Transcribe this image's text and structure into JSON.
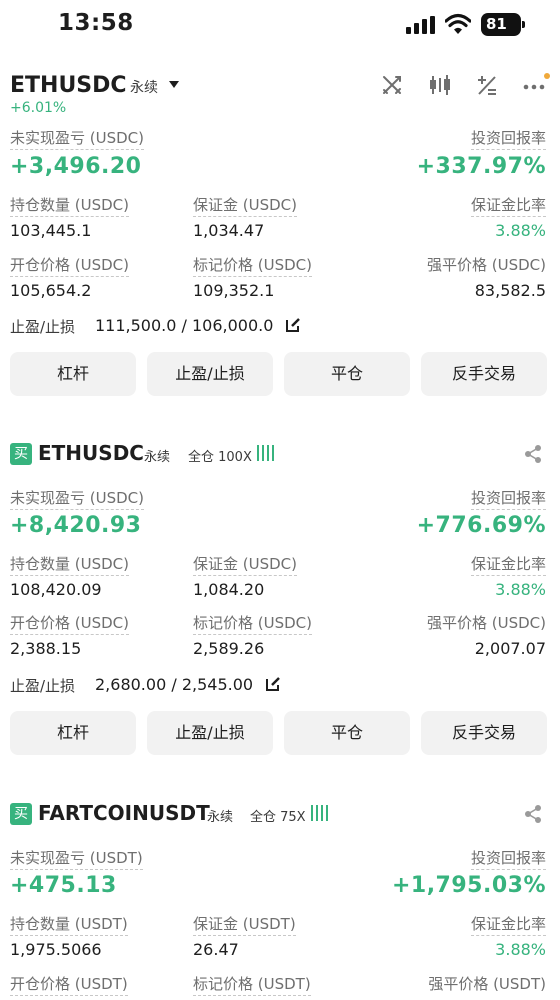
{
  "status_bar": {
    "time": "13:58",
    "battery": "81"
  },
  "header": {
    "symbol": "ETHUSDC",
    "type": "永续",
    "change": "+6.01%"
  },
  "positions": [
    {
      "symbol": "ETHUSDC",
      "type": "永续",
      "side_tag": "",
      "margin_mode": "",
      "unrealized_label": "未实现盈亏 (USDC)",
      "unrealized_value": "+3,496.20",
      "roi_label": "投资回报率",
      "roi_value": "+337.97%",
      "size_label": "持仓数量 (USDC)",
      "size_value": "103,445.1",
      "margin_label": "保证金 (USDC)",
      "margin_value": "1,034.47",
      "margin_ratio_label": "保证金比率",
      "margin_ratio_value": "3.88%",
      "entry_label": "开仓价格 (USDC)",
      "entry_value": "105,654.2",
      "mark_label": "标记价格 (USDC)",
      "mark_value": "109,352.1",
      "liq_label": "强平价格 (USDC)",
      "liq_value": "83,582.5",
      "tpsl_label": "止盈/止损",
      "tpsl_value": "111,500.0 / 106,000.0",
      "buttons": [
        "杠杆",
        "止盈/止损",
        "平仓",
        "反手交易"
      ]
    },
    {
      "symbol": "ETHUSDC",
      "type": "永续",
      "side_tag": "买",
      "margin_mode": "全仓 100X",
      "unrealized_label": "未实现盈亏 (USDC)",
      "unrealized_value": "+8,420.93",
      "roi_label": "投资回报率",
      "roi_value": "+776.69%",
      "size_label": "持仓数量 (USDC)",
      "size_value": "108,420.09",
      "margin_label": "保证金 (USDC)",
      "margin_value": "1,084.20",
      "margin_ratio_label": "保证金比率",
      "margin_ratio_value": "3.88%",
      "entry_label": "开仓价格 (USDC)",
      "entry_value": "2,388.15",
      "mark_label": "标记价格 (USDC)",
      "mark_value": "2,589.26",
      "liq_label": "强平价格 (USDC)",
      "liq_value": "2,007.07",
      "tpsl_label": "止盈/止损",
      "tpsl_value": "2,680.00 / 2,545.00",
      "buttons": [
        "杠杆",
        "止盈/止损",
        "平仓",
        "反手交易"
      ]
    },
    {
      "symbol": "FARTCOINUSDT",
      "type": "永续",
      "side_tag": "买",
      "margin_mode": "全仓 75X",
      "unrealized_label": "未实现盈亏 (USDT)",
      "unrealized_value": "+475.13",
      "roi_label": "投资回报率",
      "roi_value": "+1,795.03%",
      "size_label": "持仓数量 (USDT)",
      "size_value": "1,975.5066",
      "margin_label": "保证金 (USDT)",
      "margin_value": "26.47",
      "margin_ratio_label": "保证金比率",
      "margin_ratio_value": "3.88%",
      "entry_label": "开仓价格 (USDT)",
      "mark_label": "标记价格 (USDT)",
      "liq_label": "强平价格 (USDT)"
    }
  ],
  "colors": {
    "positive": "#37b37e",
    "accent_dot": "#f0a93b"
  },
  "icons": [
    "swap-icon",
    "candle-icon",
    "calculator-icon",
    "more-icon",
    "edit-icon",
    "share-icon"
  ]
}
